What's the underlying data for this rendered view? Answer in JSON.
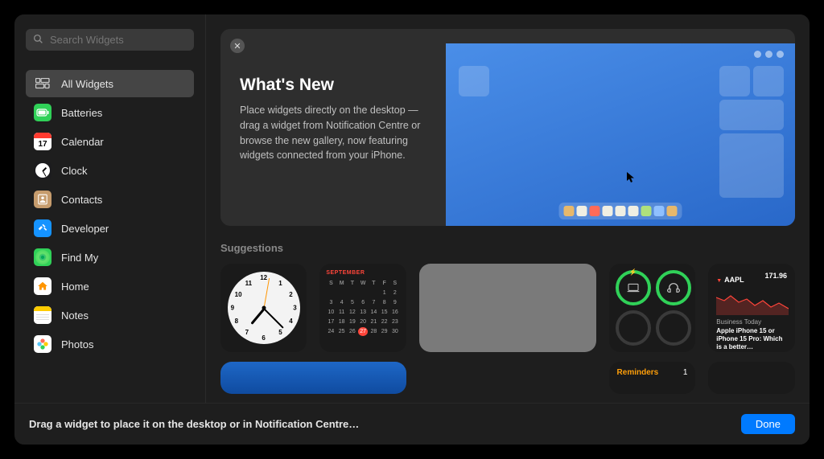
{
  "search": {
    "placeholder": "Search Widgets"
  },
  "categories": [
    {
      "label": "All Widgets",
      "icon_bg": "transparent",
      "icon_svg": "grid",
      "selected": true
    },
    {
      "label": "Batteries",
      "icon_bg": "#30d158",
      "icon_svg": "battery"
    },
    {
      "label": "Calendar",
      "icon_bg": "#ffffff",
      "icon_svg": "calendar",
      "badge": "17"
    },
    {
      "label": "Clock",
      "icon_bg": "#1c1c1e",
      "icon_svg": "clock-face"
    },
    {
      "label": "Contacts",
      "icon_bg": "#c69c6d",
      "icon_svg": "contacts"
    },
    {
      "label": "Developer",
      "icon_bg": "#1593ff",
      "icon_svg": "hammer"
    },
    {
      "label": "Find My",
      "icon_bg": "#30d158",
      "icon_svg": "radar"
    },
    {
      "label": "Home",
      "icon_bg": "#ffffff",
      "icon_svg": "house"
    },
    {
      "label": "Notes",
      "icon_bg": "#ffffff",
      "icon_svg": "notes"
    },
    {
      "label": "Photos",
      "icon_bg": "#ffffff",
      "icon_svg": "photos"
    }
  ],
  "hero": {
    "title": "What's New",
    "description": "Place widgets directly on the desktop — drag a widget from Notification Centre or browse the new gallery, now featuring widgets connected from your iPhone.",
    "dock_colors": [
      "#e7b86b",
      "#f0efe3",
      "#ff6b58",
      "#f0efe3",
      "#f0efe3",
      "#f0efe3",
      "#aee07c",
      "#8fc0ff",
      "#e7b86b"
    ]
  },
  "suggestions_header": "Suggestions",
  "calendar": {
    "month_label": "SEPTEMBER",
    "days": [
      "S",
      "M",
      "T",
      "W",
      "T",
      "F",
      "S"
    ],
    "leading_blanks": 5,
    "total_days": 30,
    "today": 27
  },
  "stocks": {
    "ticker": "AAPL",
    "price": "171.96",
    "source": "Business Today",
    "headline": "Apple iPhone 15 or iPhone 15 Pro: Which is a better…"
  },
  "reminders": {
    "label": "Reminders",
    "count": "1"
  },
  "footer": {
    "hint": "Drag a widget to place it on the desktop or in Notification Centre…",
    "done": "Done"
  }
}
